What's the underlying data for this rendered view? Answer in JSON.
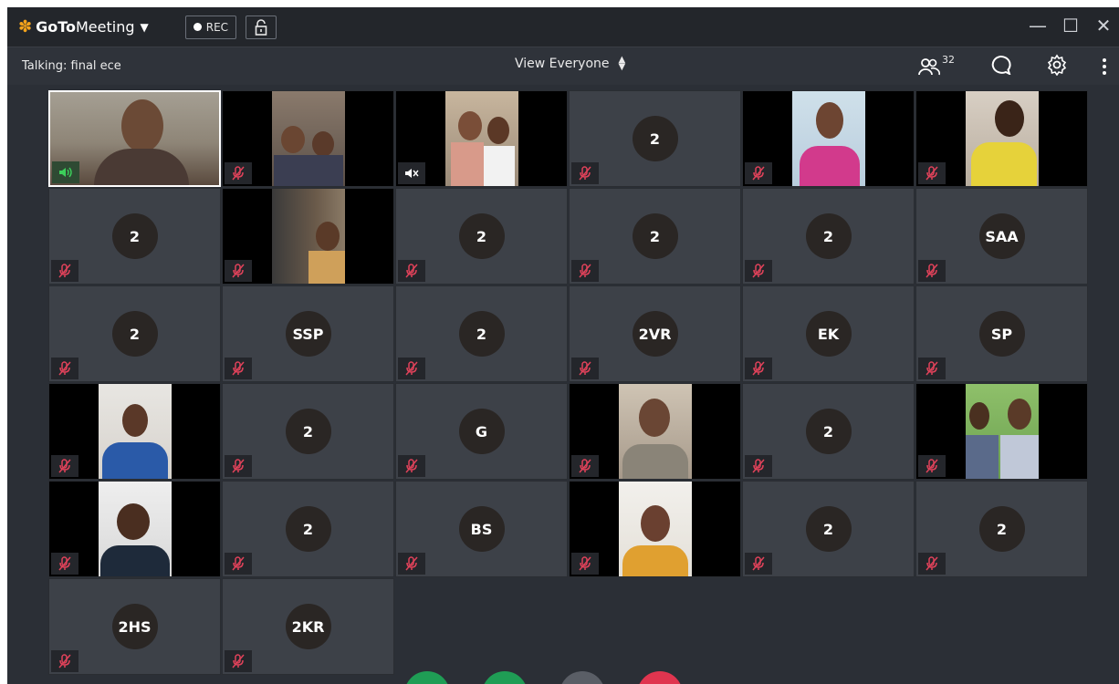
{
  "window": {
    "app_name_bold": "GoTo",
    "app_name_rest": "Meeting",
    "rec_label": "REC"
  },
  "toolbar": {
    "talking": "Talking: final ece",
    "view_selector": "View Everyone",
    "participant_count": "32"
  },
  "tiles": [
    {
      "initials": "2"
    },
    {
      "initials": "2"
    },
    {
      "initials": "2"
    },
    {
      "initials": "2"
    },
    {
      "initials": "2"
    },
    {
      "initials": "SAA"
    },
    {
      "initials": "2"
    },
    {
      "initials": "SSP"
    },
    {
      "initials": "2"
    },
    {
      "initials": "2VR"
    },
    {
      "initials": "EK"
    },
    {
      "initials": "SP"
    },
    {
      "initials": "2"
    },
    {
      "initials": "G"
    },
    {
      "initials": "2"
    },
    {
      "initials": "2"
    },
    {
      "initials": "BS"
    },
    {
      "initials": "2"
    },
    {
      "initials": "2"
    },
    {
      "initials": "2HS"
    },
    {
      "initials": "2KR"
    }
  ],
  "colors": {
    "accent_orange": "#f4a31b",
    "muted_mic": "#e0425a",
    "talking_mic": "#3ccf5a"
  }
}
